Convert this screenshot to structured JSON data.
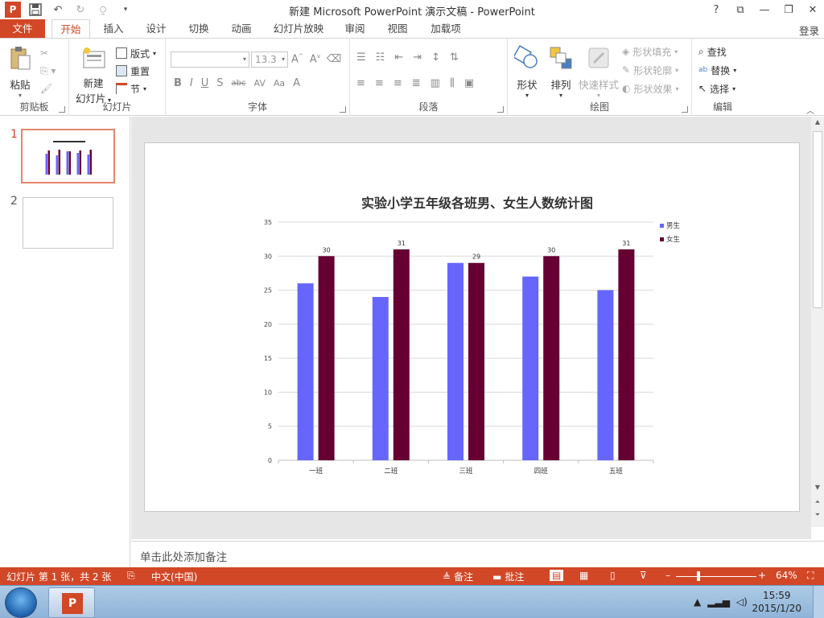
{
  "window": {
    "title": "新建 Microsoft PowerPoint 演示文稿 - PowerPoint",
    "app_logo": "P",
    "controls": [
      "?",
      "⧉",
      "—",
      "❐",
      "✕"
    ]
  },
  "tabs": {
    "file": "文件",
    "items": [
      "开始",
      "插入",
      "设计",
      "切换",
      "动画",
      "幻灯片放映",
      "审阅",
      "视图",
      "加载项"
    ],
    "active": "开始",
    "login": "登录"
  },
  "ribbon": {
    "clipboard": {
      "label": "剪贴板",
      "paste": "粘贴"
    },
    "slides": {
      "label": "幻灯片",
      "new_slide_line1": "新建",
      "new_slide_line2": "幻灯片",
      "layout": "版式",
      "reset": "重置",
      "section": "节"
    },
    "font": {
      "label": "字体",
      "font_name": "",
      "font_size": "13.3",
      "buttons": [
        "B",
        "I",
        "U",
        "S",
        "abc",
        "AV",
        "Aa",
        "A"
      ]
    },
    "paragraph": {
      "label": "段落"
    },
    "drawing": {
      "label": "绘图",
      "shapes": "形状",
      "arrange": "排列",
      "quick_styles": "快速样式",
      "shape_fill": "形状填充",
      "shape_outline": "形状轮廓",
      "shape_effects": "形状效果"
    },
    "editing": {
      "label": "编辑",
      "find": "查找",
      "replace": "替换",
      "select": "选择"
    }
  },
  "thumbnails": [
    {
      "number": "1",
      "selected": true
    },
    {
      "number": "2",
      "selected": false
    }
  ],
  "notes_placeholder": "单击此处添加备注",
  "status": {
    "slide_info": "幻灯片 第 1 张，共 2 张",
    "language": "中文(中国)",
    "notes": "备注",
    "comments": "批注",
    "zoom": "64%"
  },
  "taskbar": {
    "time": "15:59",
    "date": "2015/1/20"
  },
  "chart_data": {
    "type": "bar",
    "title": "实验小学五年级各班男、女生人数统计图",
    "categories": [
      "一班",
      "二班",
      "三班",
      "四班",
      "五班"
    ],
    "series": [
      {
        "name": "男生",
        "values": [
          26,
          24,
          29,
          27,
          25
        ],
        "color": "#6666ff"
      },
      {
        "name": "女生",
        "values": [
          30,
          31,
          29,
          30,
          31
        ],
        "color": "#660033"
      }
    ],
    "data_labels_series": "女生",
    "ylim": [
      0,
      35
    ],
    "yticks": [
      0,
      5,
      10,
      15,
      20,
      25,
      30,
      35
    ],
    "grid": true,
    "legend": "right"
  }
}
